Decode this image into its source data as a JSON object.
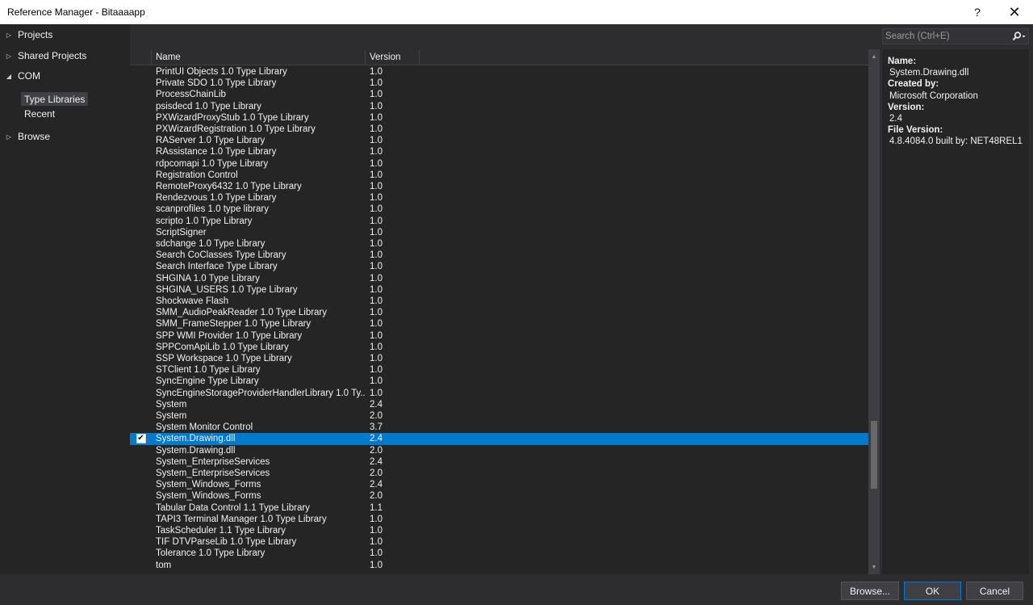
{
  "window": {
    "title": "Reference Manager - Bitaaaapp",
    "help_label": "?",
    "close_label": "✕"
  },
  "nav": {
    "projects": "Projects",
    "shared_projects": "Shared Projects",
    "com": "COM",
    "type_libraries": "Type Libraries",
    "recent": "Recent",
    "browse": "Browse"
  },
  "search": {
    "placeholder": "Search (Ctrl+E)",
    "value": ""
  },
  "columns": {
    "name": "Name",
    "version": "Version"
  },
  "rows": [
    {
      "name": "PrintUI Objects 1.0 Type Library",
      "version": "1.0"
    },
    {
      "name": "Private SDO 1.0 Type Library",
      "version": "1.0"
    },
    {
      "name": "ProcessChainLib",
      "version": "1.0"
    },
    {
      "name": "psisdecd 1.0 Type Library",
      "version": "1.0"
    },
    {
      "name": "PXWizardProxyStub 1.0 Type Library",
      "version": "1.0"
    },
    {
      "name": "PXWizardRegistration 1.0 Type Library",
      "version": "1.0"
    },
    {
      "name": "RAServer 1.0 Type Library",
      "version": "1.0"
    },
    {
      "name": "RAssistance 1.0 Type Library",
      "version": "1.0"
    },
    {
      "name": "rdpcomapi 1.0 Type Library",
      "version": "1.0"
    },
    {
      "name": "Registration Control",
      "version": "1.0"
    },
    {
      "name": "RemoteProxy6432 1.0 Type Library",
      "version": "1.0"
    },
    {
      "name": "Rendezvous 1.0 Type Library",
      "version": "1.0"
    },
    {
      "name": "scanprofiles 1.0 type library",
      "version": "1.0"
    },
    {
      "name": "scripto 1.0 Type Library",
      "version": "1.0"
    },
    {
      "name": "ScriptSigner",
      "version": "1.0"
    },
    {
      "name": "sdchange 1.0 Type Library",
      "version": "1.0"
    },
    {
      "name": "Search CoClasses Type Library",
      "version": "1.0"
    },
    {
      "name": "Search Interface Type Library",
      "version": "1.0"
    },
    {
      "name": "SHGINA 1.0 Type Library",
      "version": "1.0"
    },
    {
      "name": "SHGINA_USERS 1.0 Type Library",
      "version": "1.0"
    },
    {
      "name": "Shockwave Flash",
      "version": "1.0"
    },
    {
      "name": "SMM_AudioPeakReader 1.0 Type Library",
      "version": "1.0"
    },
    {
      "name": "SMM_FrameStepper 1.0 Type Library",
      "version": "1.0"
    },
    {
      "name": "SPP WMI Provider 1.0 Type Library",
      "version": "1.0"
    },
    {
      "name": "SPPComApiLib 1.0 Type Library",
      "version": "1.0"
    },
    {
      "name": "SSP Workspace 1.0 Type Library",
      "version": "1.0"
    },
    {
      "name": "STClient 1.0 Type Library",
      "version": "1.0"
    },
    {
      "name": "SyncEngine Type Library",
      "version": "1.0"
    },
    {
      "name": "SyncEngineStorageProviderHandlerLibrary 1.0 Ty...",
      "version": "1.0"
    },
    {
      "name": "System",
      "version": "2.4"
    },
    {
      "name": "System",
      "version": "2.0"
    },
    {
      "name": "System Monitor Control",
      "version": "3.7"
    },
    {
      "name": "System.Drawing.dll",
      "version": "2.4",
      "selected": true,
      "checked": true
    },
    {
      "name": "System.Drawing.dll",
      "version": "2.0"
    },
    {
      "name": "System_EnterpriseServices",
      "version": "2.4"
    },
    {
      "name": "System_EnterpriseServices",
      "version": "2.0"
    },
    {
      "name": "System_Windows_Forms",
      "version": "2.4"
    },
    {
      "name": "System_Windows_Forms",
      "version": "2.0"
    },
    {
      "name": "Tabular Data Control 1.1 Type Library",
      "version": "1.1"
    },
    {
      "name": "TAPI3 Terminal Manager 1.0 Type Library",
      "version": "1.0"
    },
    {
      "name": "TaskScheduler 1.1 Type Library",
      "version": "1.0"
    },
    {
      "name": "TIF DTVParseLib 1.0 Type Library",
      "version": "1.0"
    },
    {
      "name": "Tolerance 1.0 Type Library",
      "version": "1.0"
    },
    {
      "name": "tom",
      "version": "1.0"
    }
  ],
  "details": {
    "name_label": "Name:",
    "name_value": "System.Drawing.dll",
    "created_by_label": "Created by:",
    "created_by_value": "Microsoft Corporation",
    "version_label": "Version:",
    "version_value": "2.4",
    "file_version_label": "File Version:",
    "file_version_value": "4.8.4084.0 built by: NET48REL1"
  },
  "footer": {
    "browse_label": "Browse...",
    "ok_label": "OK",
    "cancel_label": "Cancel"
  },
  "colors": {
    "background": "#2d2d30",
    "panel": "#252526",
    "selection": "#007acc"
  }
}
